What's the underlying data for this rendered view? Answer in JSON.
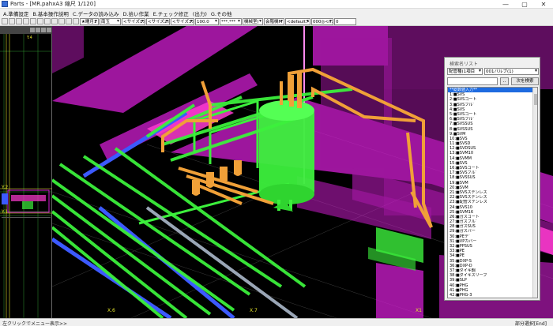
{
  "window": {
    "title": "Parts - [MR.pahxA3 縮尺 1/120]",
    "controls": [
      "—",
      "▢",
      "✕"
    ]
  },
  "menu": {
    "items": [
      "A.準備設定",
      "B.基本操作説明",
      "C.データの読み込み",
      "D.拾い作業",
      "E.チェック修正",
      "(出力)",
      "G.その他"
    ]
  },
  "toolbar": {
    "selects": [
      "★曙月1",
      "南玉",
      "<サイズ1>",
      "<サイズ2>",
      "<サイズ3>",
      "100.0",
      "***.***",
      "機械室(",
      "会階機M",
      "<default>",
      "000◎<n>"
    ],
    "number_value": "0"
  },
  "viewport_labels": {
    "left": [
      "Y.1",
      "Y.2",
      "Y.4"
    ],
    "main": [
      "X.6",
      "X.7",
      "X1"
    ]
  },
  "colors": {
    "magenta": "#d21ed2",
    "green": "#3cf03c",
    "orange": "#f0a038",
    "blue": "#3c5aff",
    "background": "#000000",
    "list_selected": "#1e6be0"
  },
  "search_panel": {
    "title": "検索名リスト",
    "select1": "配管種(1項目",
    "select2": "001バルブ(1)",
    "small_button": "..",
    "next_button": "次を検索",
    "list_items": [
      "**総数値入力**",
      "1:■SVS",
      "2:■SVSコート",
      "3:■SVSフル゛",
      "4:■SVS",
      "5:■SVSコート",
      "6:■SVSフル゛",
      "7:■SVSSUS",
      "8:■SVSSUS",
      "9:■SVM",
      "10:■SVS",
      "11:■SVSD",
      "12:■SVDSUS",
      "13:■SVM10",
      "14:■SVMM",
      "15:■SVS",
      "16:■SVSコート",
      "17:■SVSフル゛",
      "18:■SVSSUS",
      "19:■SVM",
      "20:■SVM",
      "21:■SVSステンレス",
      "22:■SVSステンレス",
      "23:■配管ステンレス",
      "24:■SVS10",
      "25:■SVM16",
      "26:■ガスコート",
      "27:■ガスフル゛",
      "28:■ガスSUS",
      "29:■ガスバー",
      "30:■PEテ゛",
      "31:■VPカバー",
      "32:■PPSUS",
      "33:■PE",
      "34:■PE",
      "35:■DXP-S",
      "36:■DXP-D",
      "37:■ダイキ鋼",
      "38:■ダイキスリーブ",
      "39:■SLP",
      "40:■PHG",
      "41:■PHG",
      "42:■PHG-3",
      "43:■樹脂管"
    ]
  },
  "statusbar": {
    "left": "左クリックでメニュー表示>>",
    "right": "部分選択[End]"
  }
}
